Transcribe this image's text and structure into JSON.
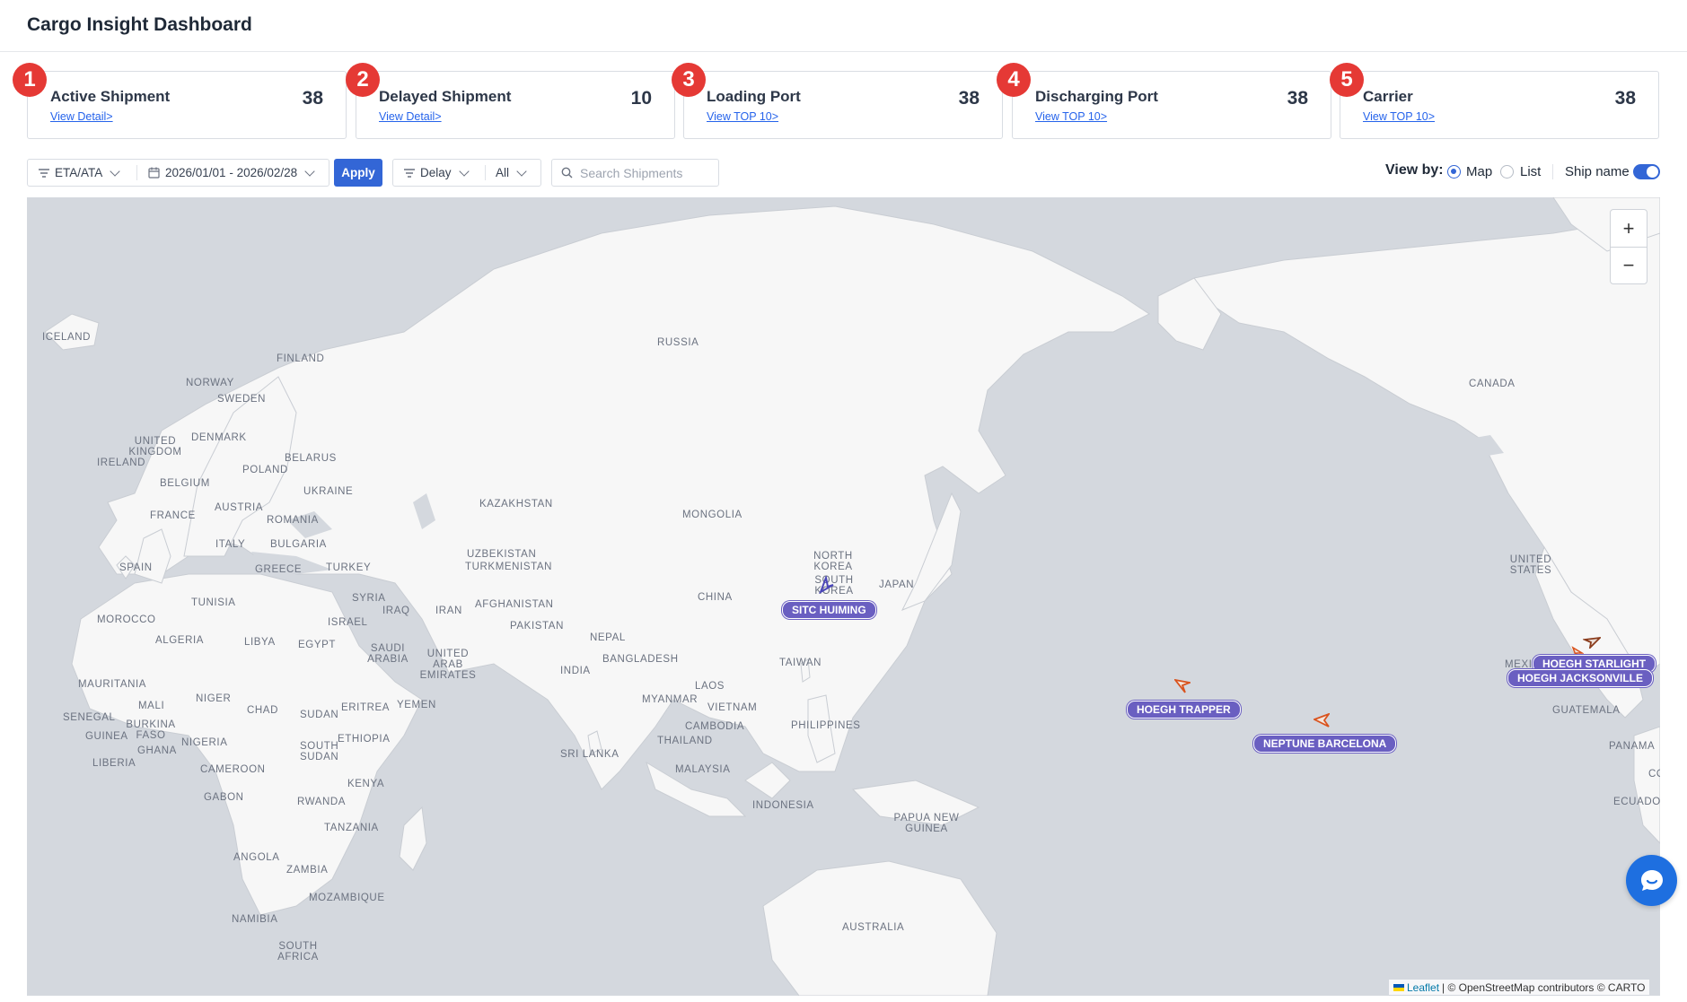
{
  "header": {
    "title": "Cargo Insight Dashboard"
  },
  "cards": [
    {
      "badge": "1",
      "title": "Active Shipment",
      "link": "View Detail>",
      "value": "38"
    },
    {
      "badge": "2",
      "title": "Delayed Shipment",
      "link": "View Detail>",
      "value": "10"
    },
    {
      "badge": "3",
      "title": "Loading Port",
      "link": "View TOP 10>",
      "value": "38"
    },
    {
      "badge": "4",
      "title": "Discharging Port",
      "link": "View TOP 10>",
      "value": "38"
    },
    {
      "badge": "5",
      "title": "Carrier",
      "link": "View TOP 10>",
      "value": "38"
    }
  ],
  "filters": {
    "date_type": "ETA/ATA",
    "date_range": "2026/01/01 - 2026/02/28",
    "apply_label": "Apply",
    "status": "Delay",
    "status_value": "All",
    "search_placeholder": "Search Shipments"
  },
  "view": {
    "label": "View by:",
    "map_label": "Map",
    "list_label": "List",
    "selected": "Map",
    "ship_name_label": "Ship name",
    "ship_name_on": true
  },
  "map": {
    "zoom_in": "+",
    "zoom_out": "−",
    "labels": [
      "ICELAND",
      "FINLAND",
      "NORWAY",
      "SWEDEN",
      "UNITED KINGDOM",
      "IRELAND",
      "DENMARK",
      "BELARUS",
      "POLAND",
      "BELGIUM",
      "UKRAINE",
      "FRANCE",
      "AUSTRIA",
      "ROMANIA",
      "ITALY",
      "BULGARIA",
      "SPAIN",
      "GREECE",
      "TURKEY",
      "TUNISIA",
      "SYRIA",
      "IRAQ",
      "IRAN",
      "ISRAEL",
      "MOROCCO",
      "ALGERIA",
      "LIBYA",
      "EGYPT",
      "SAUDI ARABIA",
      "UNITED ARAB EMIRATES",
      "MAURITANIA",
      "MALI",
      "NIGER",
      "CHAD",
      "SUDAN",
      "ERITREA",
      "YEMEN",
      "SENEGAL",
      "BURKINA FASO",
      "GUINEA",
      "GHANA",
      "NIGERIA",
      "SOUTH SUDAN",
      "ETHIOPIA",
      "LIBERIA",
      "CAMEROON",
      "GABON",
      "KENYA",
      "RWANDA",
      "TANZANIA",
      "ANGOLA",
      "ZAMBIA",
      "MOZAMBIQUE",
      "NAMIBIA",
      "SOUTH AFRICA",
      "RUSSIA",
      "KAZAKHSTAN",
      "UZBEKISTAN",
      "TURKMENISTAN",
      "AFGHANISTAN",
      "PAKISTAN",
      "MONGOLIA",
      "CHINA",
      "NEPAL",
      "BANGLADESH",
      "INDIA",
      "SRI LANKA",
      "MYANMAR",
      "LAOS",
      "VIETNAM",
      "CAMBODIA",
      "THAILAND",
      "MALAYSIA",
      "INDONESIA",
      "PHILIPPINES",
      "TAIWAN",
      "NORTH KOREA",
      "SOUTH KOREA",
      "JAPAN",
      "PAPUA NEW GUINEA",
      "AUSTRALIA",
      "CANADA",
      "UNITED STATES",
      "MEXICO",
      "GUATEMALA",
      "PANAMA",
      "ECUADOR",
      "CO"
    ],
    "ships": [
      "SITC HUIMING",
      "HOEGH TRAPPER",
      "NEPTUNE BARCELONA",
      "HOEGH STARLIGHT",
      "HOEGH JACKSONVILLE"
    ],
    "attribution": {
      "leaflet": "Leaflet",
      "rest": "| © OpenStreetMap contributors © CARTO"
    }
  },
  "colors": {
    "accent": "#3366d6",
    "badge": "#e53935",
    "ship_tag": "#6a5fc1",
    "ship_arrow": "#d9531e",
    "land": "#f7f7f7",
    "water": "#d4d8de"
  },
  "icons": {
    "filter": "filter-icon",
    "calendar": "calendar-icon",
    "search": "search-icon",
    "chat": "chat-icon"
  }
}
